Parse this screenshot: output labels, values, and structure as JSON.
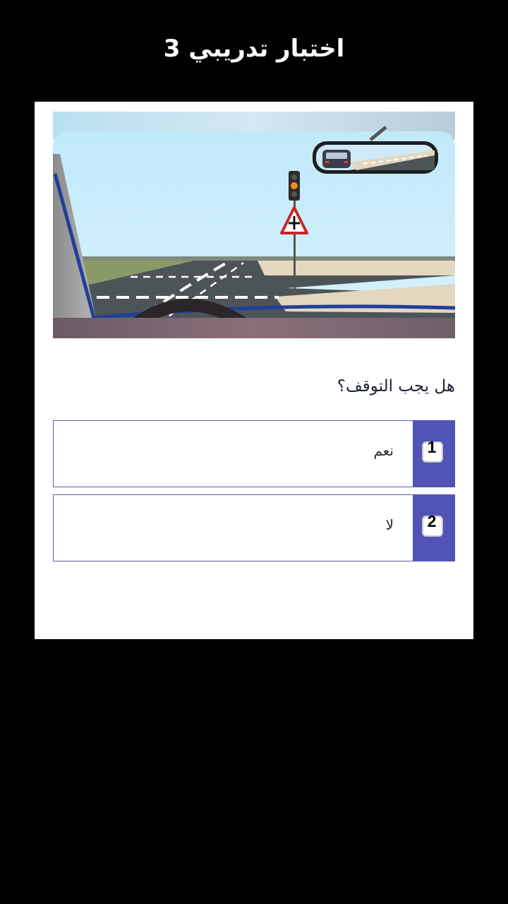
{
  "header": {
    "title": "اختبار تدريبي 3"
  },
  "quiz": {
    "question": "هل يجب التوقف؟",
    "answers": [
      {
        "number": "1",
        "label": "نعم"
      },
      {
        "number": "2",
        "label": "لا"
      }
    ]
  },
  "colors": {
    "background": "#000000",
    "card": "#ffffff",
    "accent": "#5254b5",
    "answer_border": "#5a5fa8",
    "sky": "#cdeefd"
  },
  "icons": {
    "traffic_light": "traffic-light-icon",
    "warning_sign": "crossroads-warning-sign-icon",
    "rear_mirror": "rear-view-mirror-icon"
  }
}
